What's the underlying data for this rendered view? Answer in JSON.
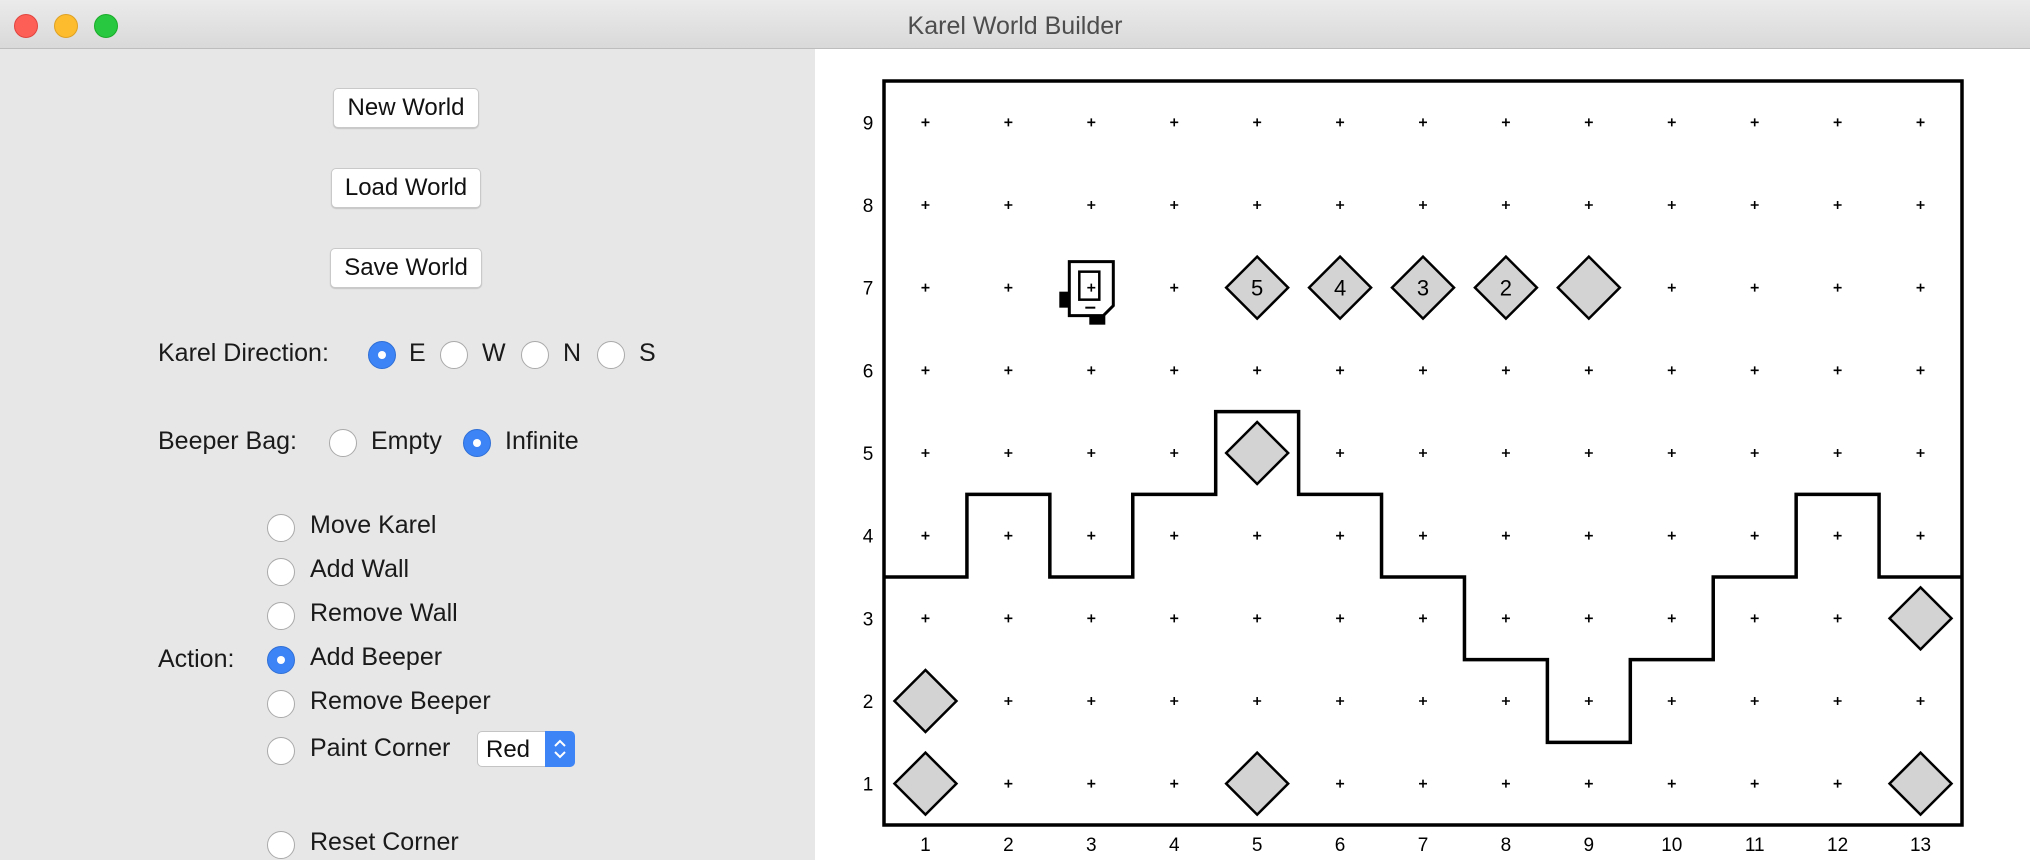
{
  "window": {
    "title": "Karel World Builder"
  },
  "buttons": {
    "new_world": "New World",
    "load_world": "Load World",
    "save_world": "Save World"
  },
  "direction": {
    "label": "Karel Direction:",
    "options": [
      "E",
      "W",
      "N",
      "S"
    ],
    "selected": "E"
  },
  "beeper_bag": {
    "label": "Beeper Bag:",
    "options": [
      "Empty",
      "Infinite"
    ],
    "selected": "Infinite"
  },
  "action": {
    "label": "Action:",
    "options": [
      "Move Karel",
      "Add Wall",
      "Remove Wall",
      "Add Beeper",
      "Remove Beeper",
      "Paint Corner",
      "Reset Corner"
    ],
    "selected": "Add Beeper",
    "paint_color": "Red"
  },
  "colors": {
    "accent": "#3d84f6",
    "beeper_fill": "#d3d3d3",
    "wall": "#000000"
  },
  "world": {
    "columns": [
      "1",
      "2",
      "3",
      "4",
      "5",
      "6",
      "7",
      "8",
      "9",
      "10",
      "11",
      "12",
      "13"
    ],
    "rows": [
      "1",
      "2",
      "3",
      "4",
      "5",
      "6",
      "7",
      "8",
      "9"
    ],
    "karel": {
      "col": 3,
      "row": 7,
      "facing": "E"
    },
    "beepers": [
      {
        "col": 5,
        "row": 7,
        "count": "5"
      },
      {
        "col": 6,
        "row": 7,
        "count": "4"
      },
      {
        "col": 7,
        "row": 7,
        "count": "3"
      },
      {
        "col": 8,
        "row": 7,
        "count": "2"
      },
      {
        "col": 9,
        "row": 7,
        "count": ""
      },
      {
        "col": 5,
        "row": 5,
        "count": ""
      },
      {
        "col": 13,
        "row": 3,
        "count": ""
      },
      {
        "col": 1,
        "row": 2,
        "count": ""
      },
      {
        "col": 1,
        "row": 1,
        "count": ""
      },
      {
        "col": 5,
        "row": 1,
        "count": ""
      },
      {
        "col": 13,
        "row": 1,
        "count": ""
      }
    ],
    "wall_heights": [
      3,
      4,
      3,
      4,
      5,
      4,
      3,
      2,
      1,
      2,
      3,
      4,
      3
    ]
  }
}
